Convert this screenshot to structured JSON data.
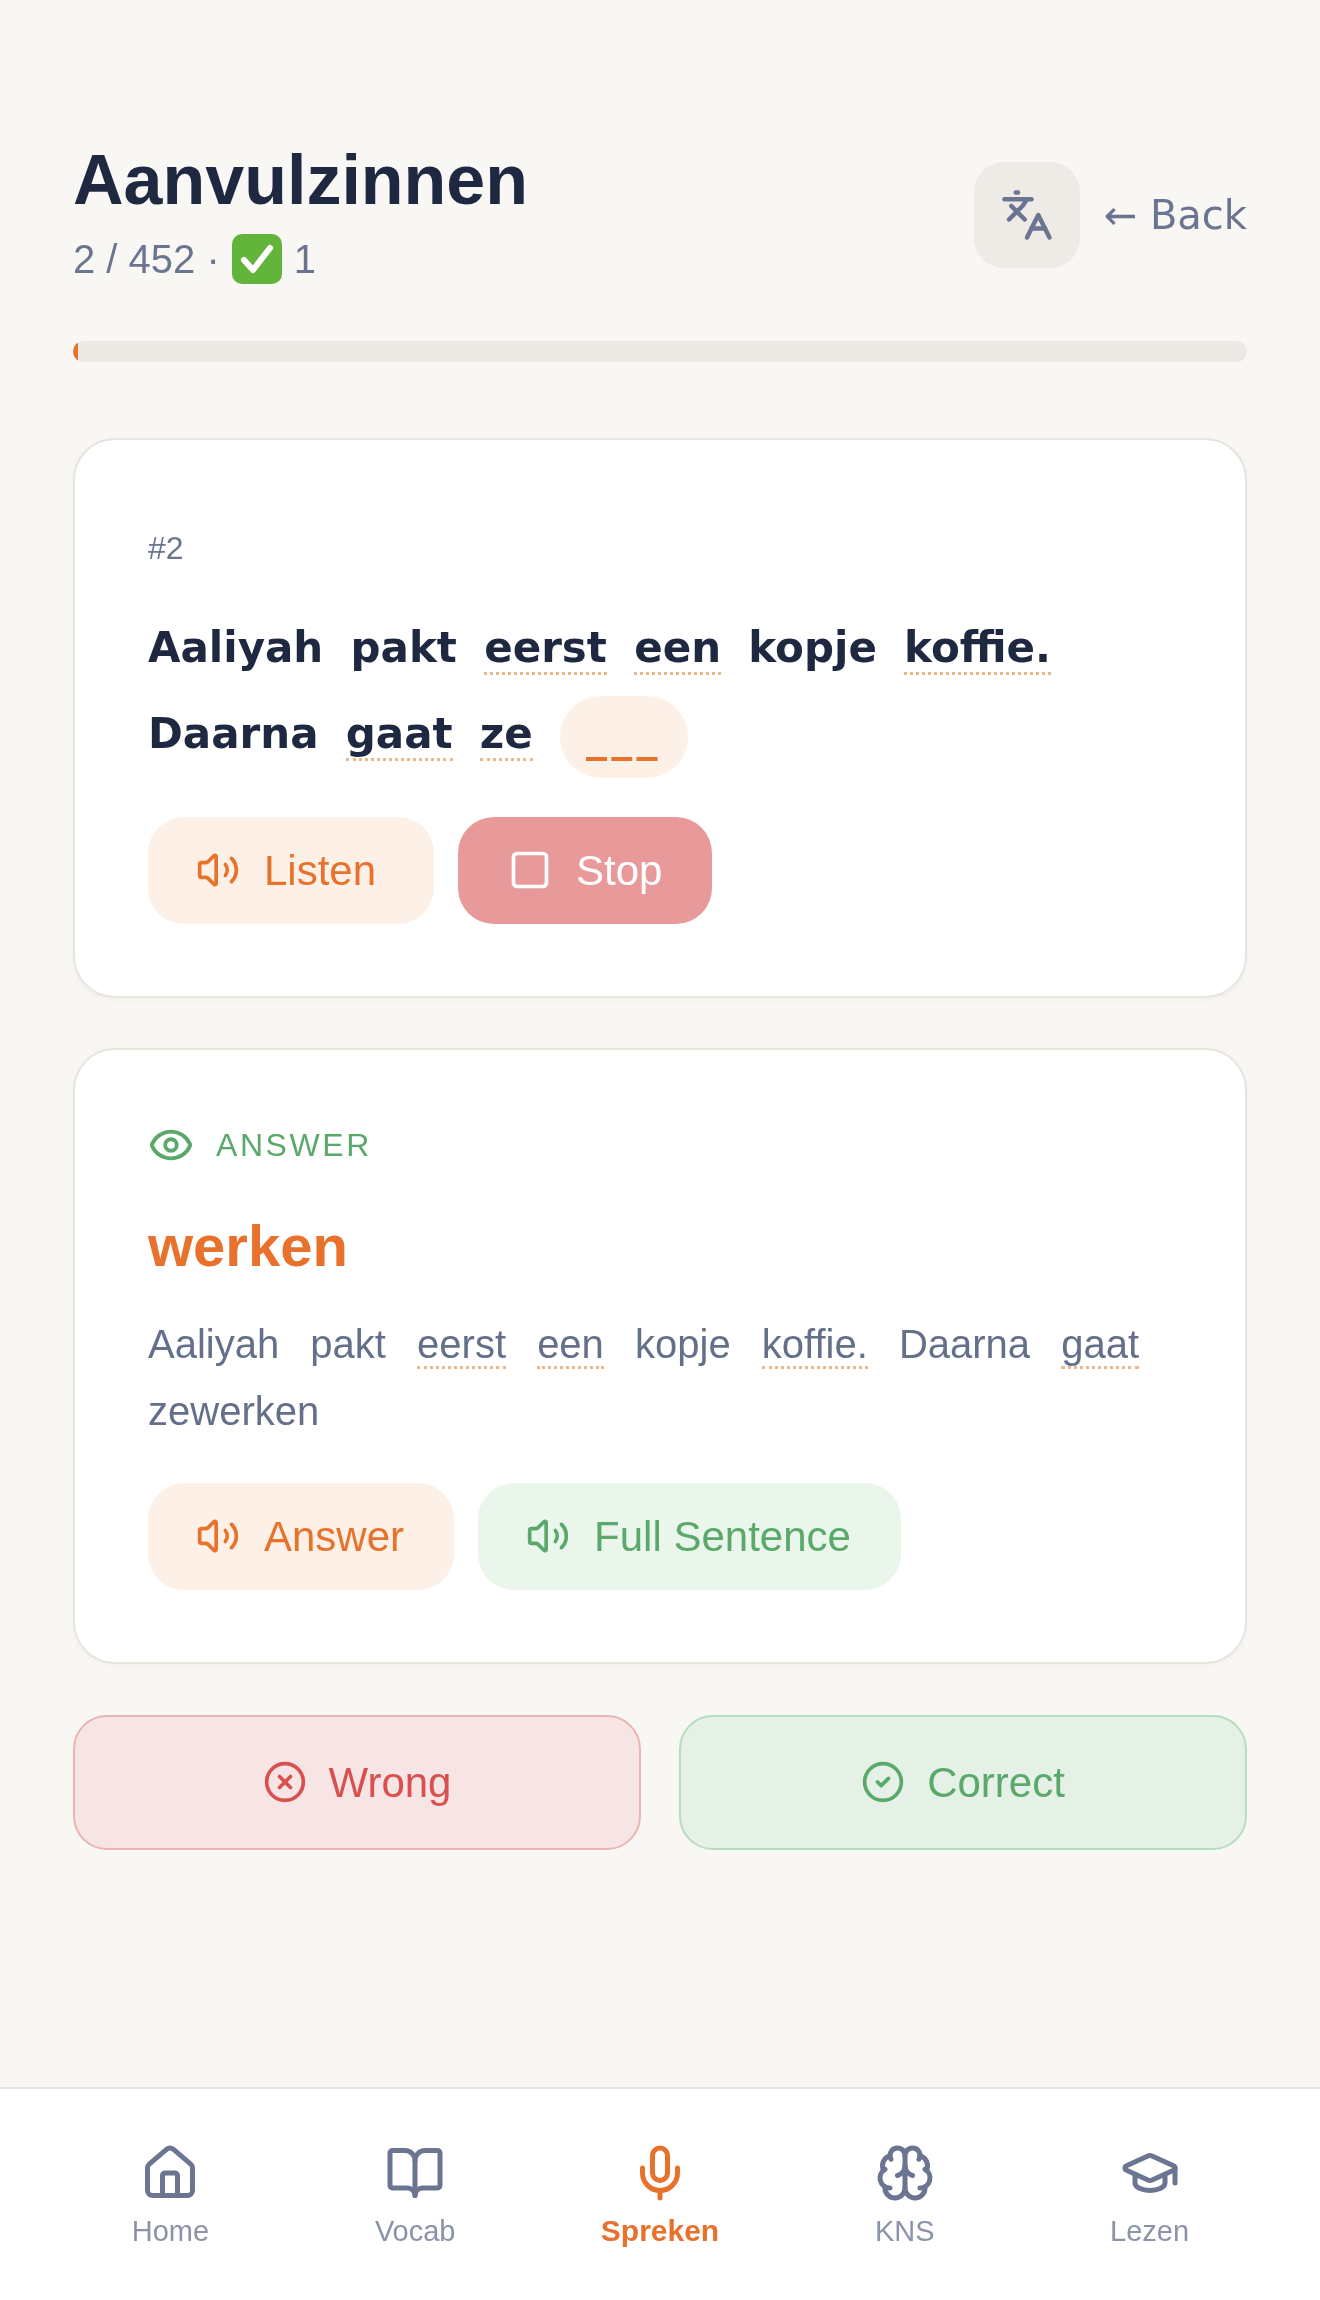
{
  "header": {
    "title": "Aanvulzinnen",
    "progress_text": "2 / 452 ·",
    "correct_count": "1",
    "back_link": "← Back"
  },
  "progress": {
    "level": 0.004
  },
  "question_card": {
    "number": "#2",
    "words": [
      {
        "text": "Aaliyah",
        "underlined": false
      },
      {
        "text": "pakt",
        "underlined": false
      },
      {
        "text": "eerst",
        "underlined": true
      },
      {
        "text": "een",
        "underlined": true
      },
      {
        "text": "kopje",
        "underlined": false
      },
      {
        "text": "koffie.",
        "underlined": true
      },
      {
        "text": "Daarna",
        "underlined": false
      },
      {
        "text": "gaat",
        "underlined": true
      },
      {
        "text": "ze",
        "underlined": true
      }
    ],
    "blank": "___",
    "buttons": [
      {
        "label": "Listen",
        "kind": "listen"
      },
      {
        "label": "Stop",
        "kind": "stop"
      }
    ]
  },
  "answer_card": {
    "heading": "ANSWER",
    "answer": "werken",
    "words": [
      {
        "text": "Aaliyah",
        "underlined": false
      },
      {
        "text": "pakt",
        "underlined": false
      },
      {
        "text": "eerst",
        "underlined": true
      },
      {
        "text": "een",
        "underlined": true
      },
      {
        "text": "kopje",
        "underlined": false
      },
      {
        "text": "koffie.",
        "underlined": true
      },
      {
        "text": "Daarna",
        "underlined": false
      },
      {
        "text": "gaat",
        "underlined": true
      },
      {
        "text": "zewerken",
        "underlined": false
      }
    ],
    "buttons": [
      {
        "label": "Answer",
        "kind": "answer"
      },
      {
        "label": "Full Sentence",
        "kind": "sentence"
      }
    ]
  },
  "grading_buttons": [
    {
      "label": "Wrong",
      "kind": "wrong"
    },
    {
      "label": "Correct",
      "kind": "correct"
    }
  ],
  "nav": {
    "items": [
      {
        "label": "Home",
        "kind": "home",
        "selected": false
      },
      {
        "label": "Vocab",
        "kind": "vocab",
        "selected": false
      },
      {
        "label": "Spreken",
        "kind": "speaking",
        "selected": true
      },
      {
        "label": "KNS",
        "kind": "kns",
        "selected": false
      },
      {
        "label": "Lezen",
        "kind": "reading",
        "selected": false
      }
    ]
  }
}
